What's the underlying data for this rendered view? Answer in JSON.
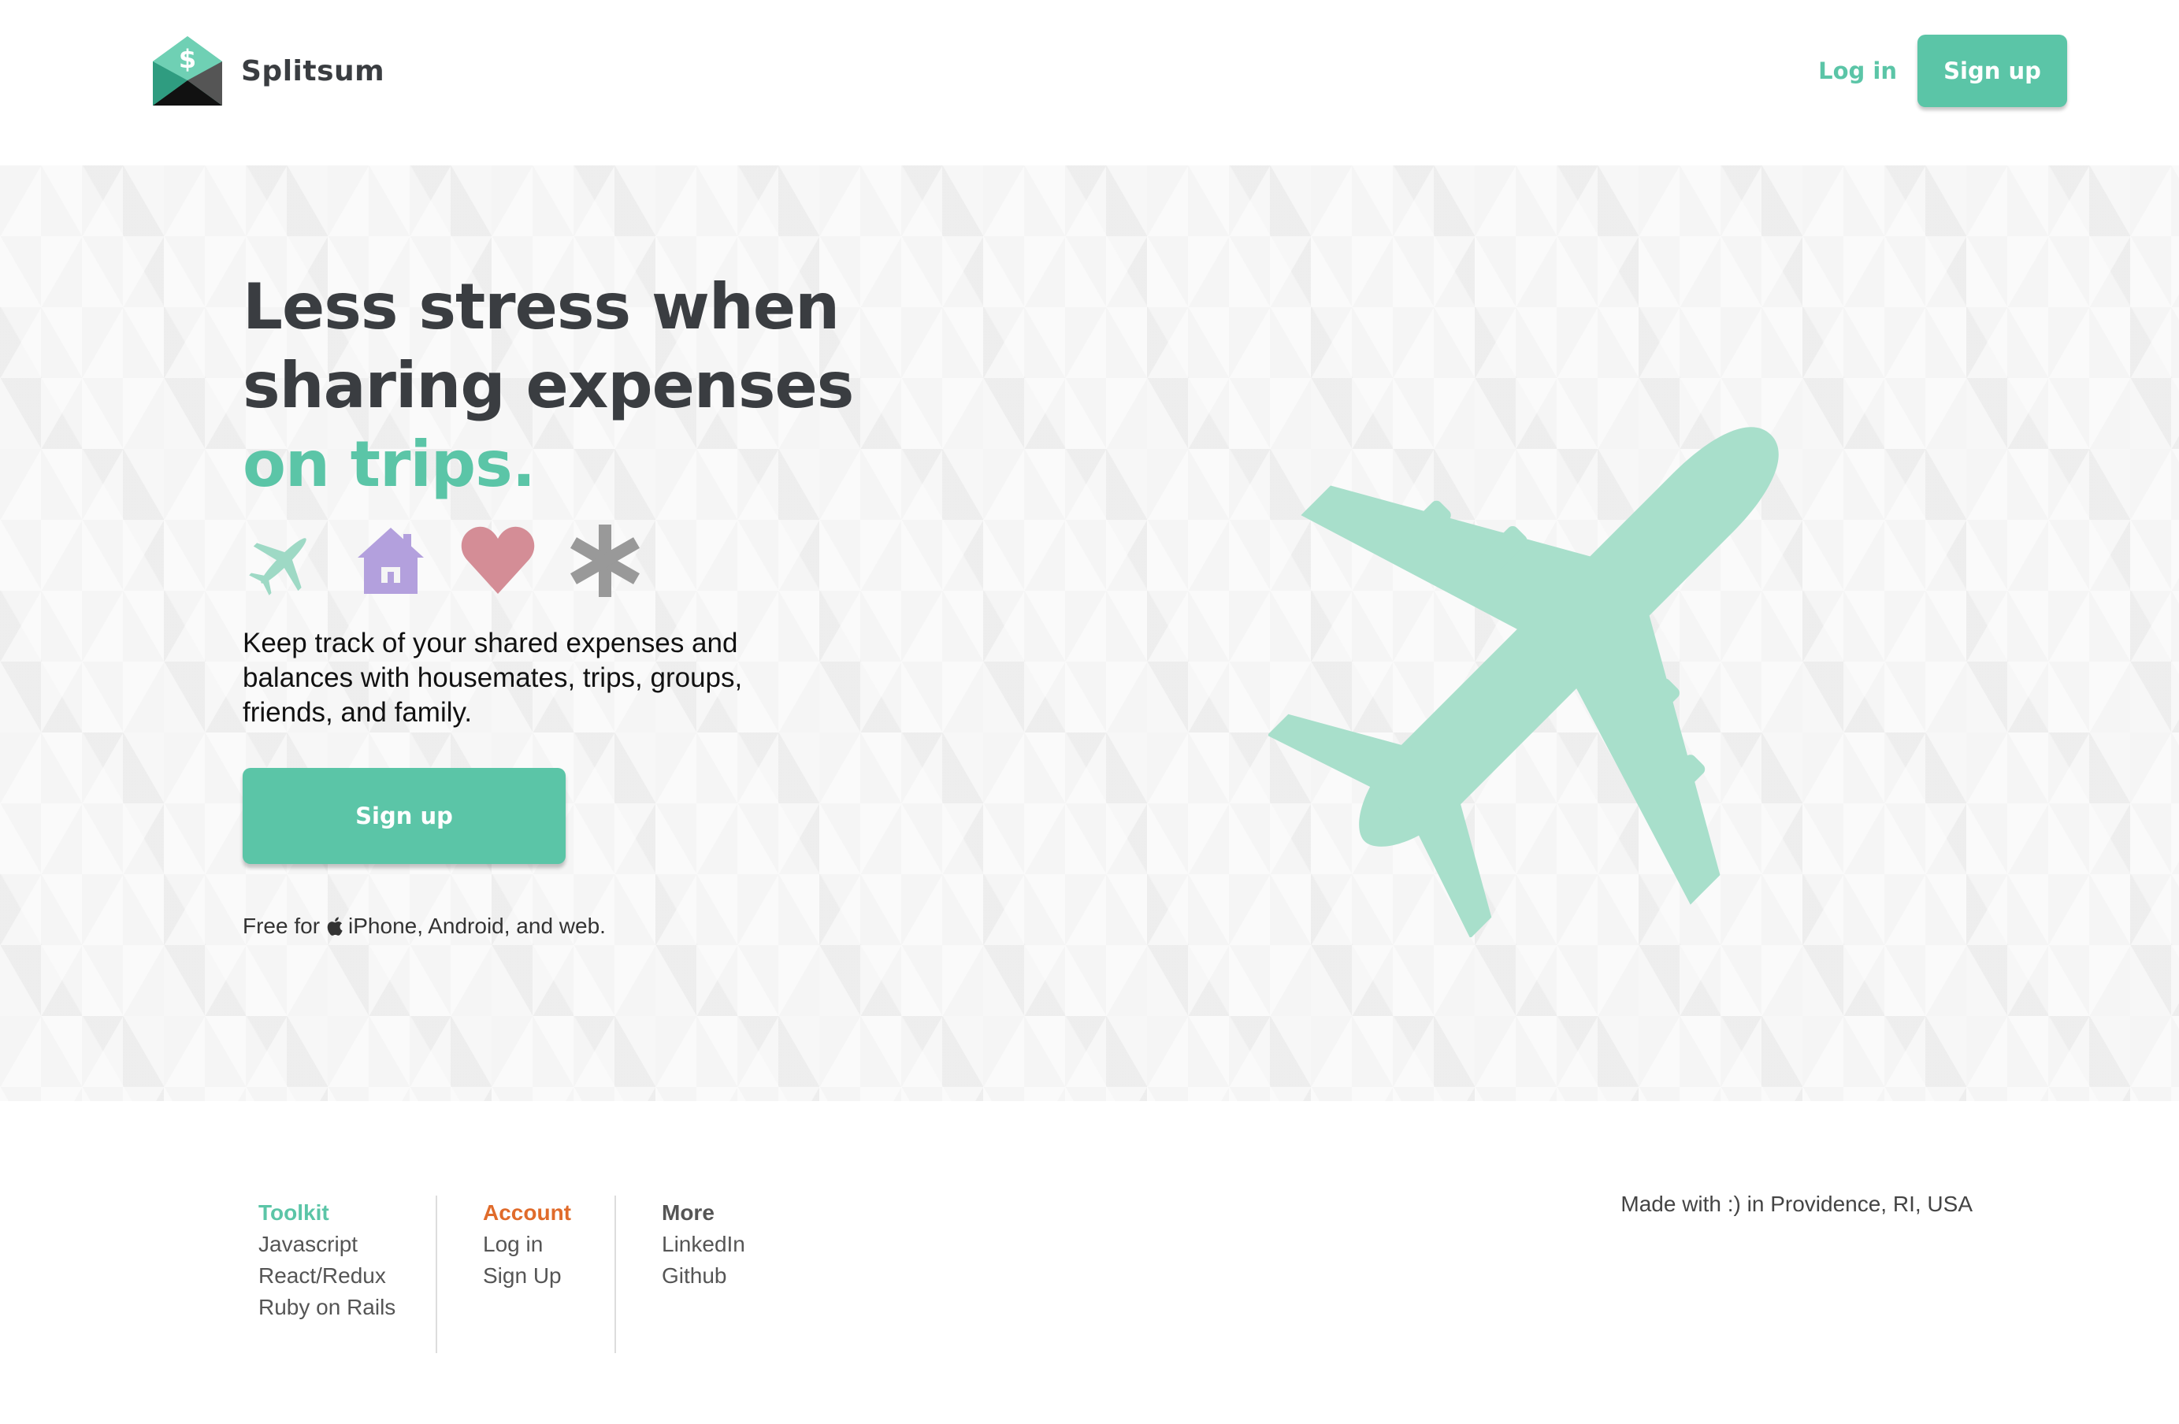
{
  "brand": {
    "name": "Splitsum",
    "accent_color": "#5bc5a7",
    "dark_color": "#3a3d41"
  },
  "header": {
    "login_label": "Log in",
    "signup_label": "Sign up"
  },
  "hero": {
    "headline_line1": "Less stress when",
    "headline_line2": "sharing expenses",
    "headline_accent": "on trips.",
    "category_icons": [
      "plane-icon",
      "house-icon",
      "heart-icon",
      "asterisk-icon"
    ],
    "tagline": "Keep track of your shared expenses and balances with housemates, trips, groups, friends, and family.",
    "signup_label": "Sign up",
    "platforms_prefix": "Free for",
    "platforms_suffix": "iPhone, Android, and web."
  },
  "footer": {
    "toolkit": {
      "title": "Toolkit",
      "links": [
        "Javascript",
        "React/Redux",
        "Ruby on Rails"
      ]
    },
    "account": {
      "title": "Account",
      "links": [
        "Log in",
        "Sign Up"
      ]
    },
    "more": {
      "title": "More",
      "links": [
        "LinkedIn",
        "Github"
      ]
    },
    "made_with": "Made with :) in Providence, RI, USA"
  }
}
